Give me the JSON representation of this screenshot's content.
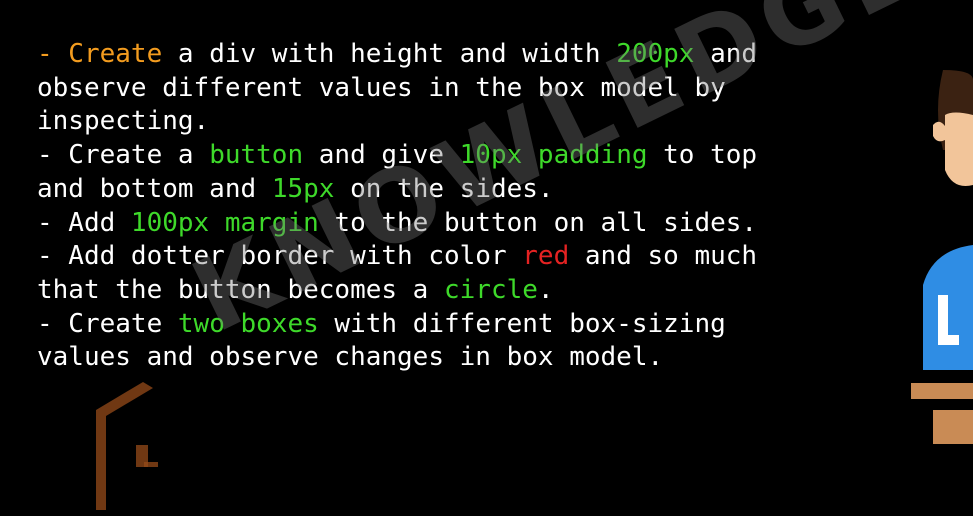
{
  "terminal": {
    "lines": [
      [
        {
          "text": "- Create",
          "color": "orange"
        },
        {
          "text": " a div with height and width ",
          "color": "white"
        },
        {
          "text": "200px",
          "color": "green"
        },
        {
          "text": " and",
          "color": "white"
        }
      ],
      [
        {
          "text": "observe different values in the box model by",
          "color": "white"
        }
      ],
      [
        {
          "text": "inspecting.",
          "color": "white"
        }
      ],
      [
        {
          "text": "- Create a ",
          "color": "white"
        },
        {
          "text": "button",
          "color": "green"
        },
        {
          "text": " and give ",
          "color": "white"
        },
        {
          "text": "10px padding",
          "color": "green"
        },
        {
          "text": " to top",
          "color": "white"
        }
      ],
      [
        {
          "text": "and bottom and ",
          "color": "white"
        },
        {
          "text": "15px",
          "color": "green"
        },
        {
          "text": " on the sides.",
          "color": "white"
        }
      ],
      [
        {
          "text": "- Add ",
          "color": "white"
        },
        {
          "text": "100px margin",
          "color": "green"
        },
        {
          "text": " to the button on all sides.",
          "color": "white"
        }
      ],
      [
        {
          "text": "- Add dotter border with color ",
          "color": "white"
        },
        {
          "text": "red",
          "color": "red"
        },
        {
          "text": " and so much",
          "color": "white"
        }
      ],
      [
        {
          "text": "that the button becomes a ",
          "color": "white"
        },
        {
          "text": "circle",
          "color": "green"
        },
        {
          "text": ".",
          "color": "white"
        }
      ],
      [
        {
          "text": "- Create ",
          "color": "white"
        },
        {
          "text": "two boxes",
          "color": "green"
        },
        {
          "text": " with different box-sizing",
          "color": "white"
        }
      ],
      [
        {
          "text": "values and observe changes in box model.",
          "color": "white"
        }
      ]
    ]
  },
  "watermark": {
    "text": "KNOWLEDGE",
    "icon": "knowledge-gate-logo-icon"
  },
  "avatar": {
    "icon": "presenter-avatar-icon"
  },
  "colors": {
    "background": "#000000",
    "text": "#ffffff",
    "orange": "#f39c1f",
    "green": "#3ed92a",
    "red": "#e52222"
  }
}
